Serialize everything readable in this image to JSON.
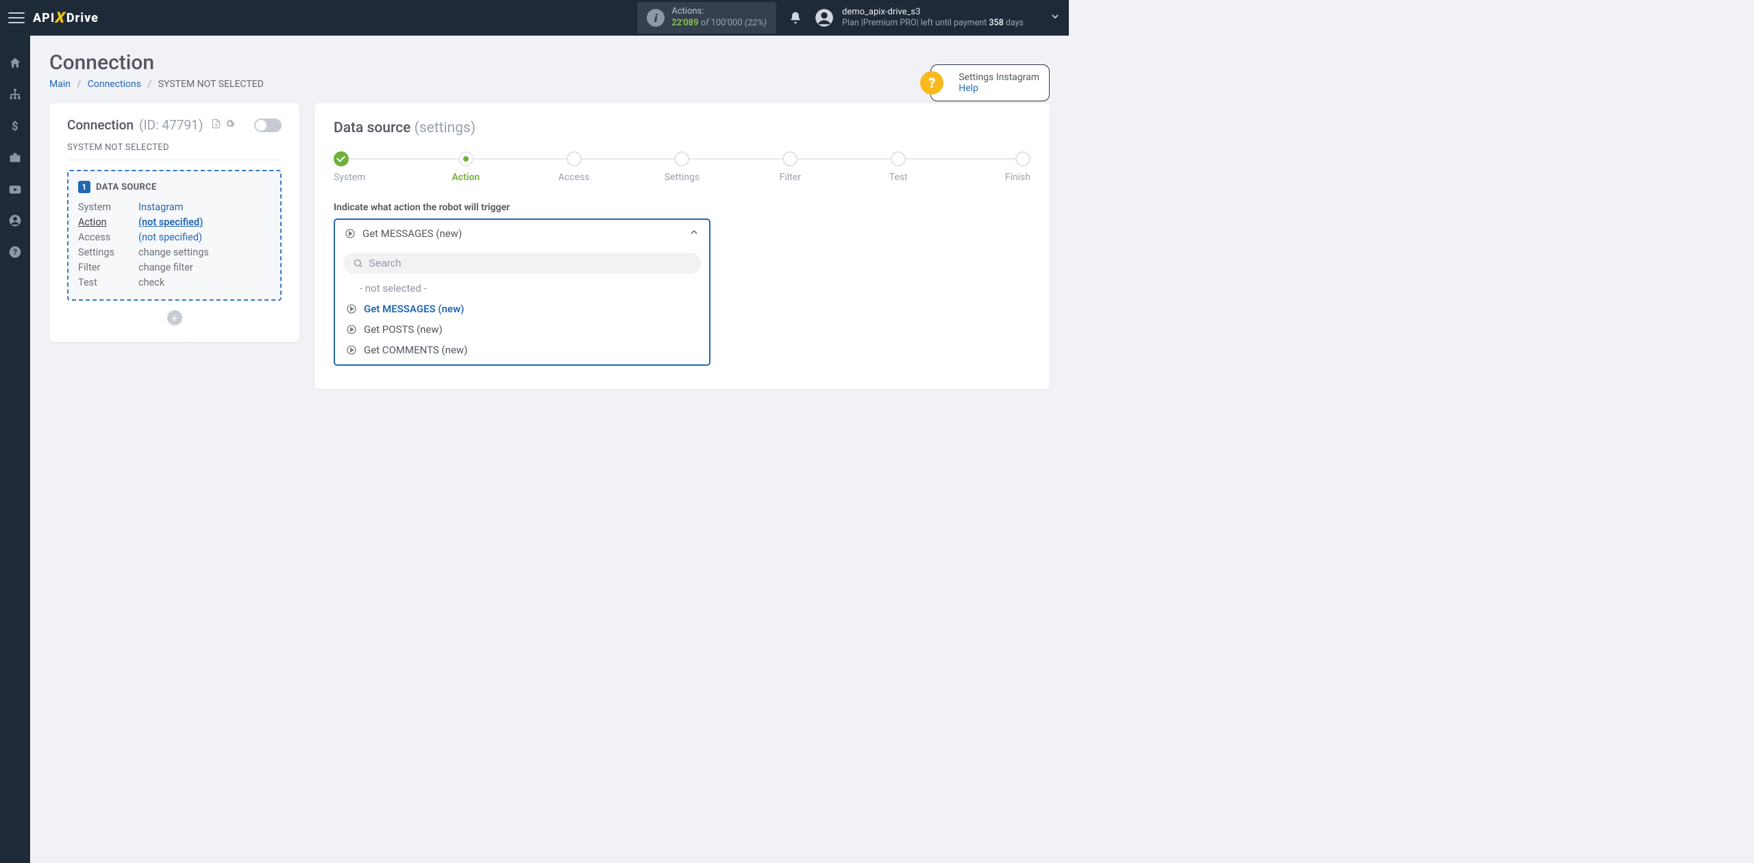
{
  "header": {
    "logo_left": "API",
    "logo_right": "Drive",
    "actions_label": "Actions:",
    "actions_used": "22'089",
    "actions_of": "of",
    "actions_total": "100'000",
    "actions_pct": "(22%)",
    "user_name": "demo_apix-drive_s3",
    "plan_prefix": "Plan |Premium PRO| left until payment ",
    "plan_days": "358",
    "plan_suffix": " days"
  },
  "page": {
    "title": "Connection",
    "crumbs": {
      "main": "Main",
      "connections": "Connections",
      "current": "SYSTEM NOT SELECTED"
    },
    "help_title": "Settings Instagram",
    "help_link": "Help"
  },
  "left": {
    "title": "Connection",
    "id_label": "(ID: 47791)",
    "sub": "SYSTEM NOT SELECTED",
    "ds_badge": "1",
    "ds_title": "DATA SOURCE",
    "rows": {
      "system_k": "System",
      "system_v": "Instagram",
      "action_k": "Action",
      "action_v": "(not specified)",
      "access_k": "Access",
      "access_v": "(not specified)",
      "settings_k": "Settings",
      "settings_v": "change settings",
      "filter_k": "Filter",
      "filter_v": "change filter",
      "test_k": "Test",
      "test_v": "check"
    }
  },
  "right": {
    "title": "Data source",
    "title_sub": "(settings)",
    "steps": {
      "system": "System",
      "action": "Action",
      "access": "Access",
      "settings": "Settings",
      "filter": "Filter",
      "test": "Test",
      "finish": "Finish"
    },
    "field_label": "Indicate what action the robot will trigger",
    "selected": "Get MESSAGES (new)",
    "search_ph": "Search",
    "opt_none": "- not selected -",
    "options": {
      "messages": "Get MESSAGES (new)",
      "posts": "Get POSTS (new)",
      "comments": "Get COMMENTS (new)"
    }
  }
}
